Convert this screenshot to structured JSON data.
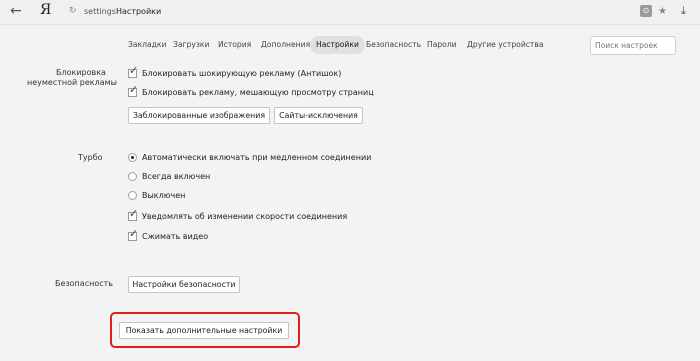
{
  "browser": {
    "logo": "Я",
    "url_scheme": "settings",
    "url_title": "Настройки"
  },
  "tabs": [
    {
      "label": "Закладки"
    },
    {
      "label": "Загрузки"
    },
    {
      "label": "История"
    },
    {
      "label": "Дополнения"
    },
    {
      "label": "Настройки",
      "active": true
    },
    {
      "label": "Безопасность"
    },
    {
      "label": "Пароли"
    },
    {
      "label": "Другие устройства"
    }
  ],
  "search": {
    "placeholder": "Поиск настроек"
  },
  "ads": {
    "label_line1": "Блокировка",
    "label_line2": "неуместной рекламы",
    "options": [
      {
        "label": "Блокировать шокирующую рекламу (Антишок)",
        "checked": true
      },
      {
        "label": "Блокировать рекламу, мешающую просмотру страниц",
        "checked": true
      }
    ],
    "buttons": [
      "Заблокированные изображения",
      "Сайты-исключения"
    ]
  },
  "turbo": {
    "label": "Турбо",
    "radios": [
      {
        "label": "Автоматически включать при медленном соединении",
        "selected": true
      },
      {
        "label": "Всегда включен",
        "selected": false
      },
      {
        "label": "Выключен",
        "selected": false
      }
    ],
    "options": [
      {
        "label": "Уведомлять об изменении скорости соединения",
        "checked": true
      },
      {
        "label": "Сжимать видео",
        "checked": true
      }
    ]
  },
  "security": {
    "label": "Безопасность",
    "button": "Настройки безопасности"
  },
  "more_button": "Показать дополнительные настройки",
  "colors": {
    "highlight": "#e0201a",
    "background": "#f3f3f3"
  }
}
